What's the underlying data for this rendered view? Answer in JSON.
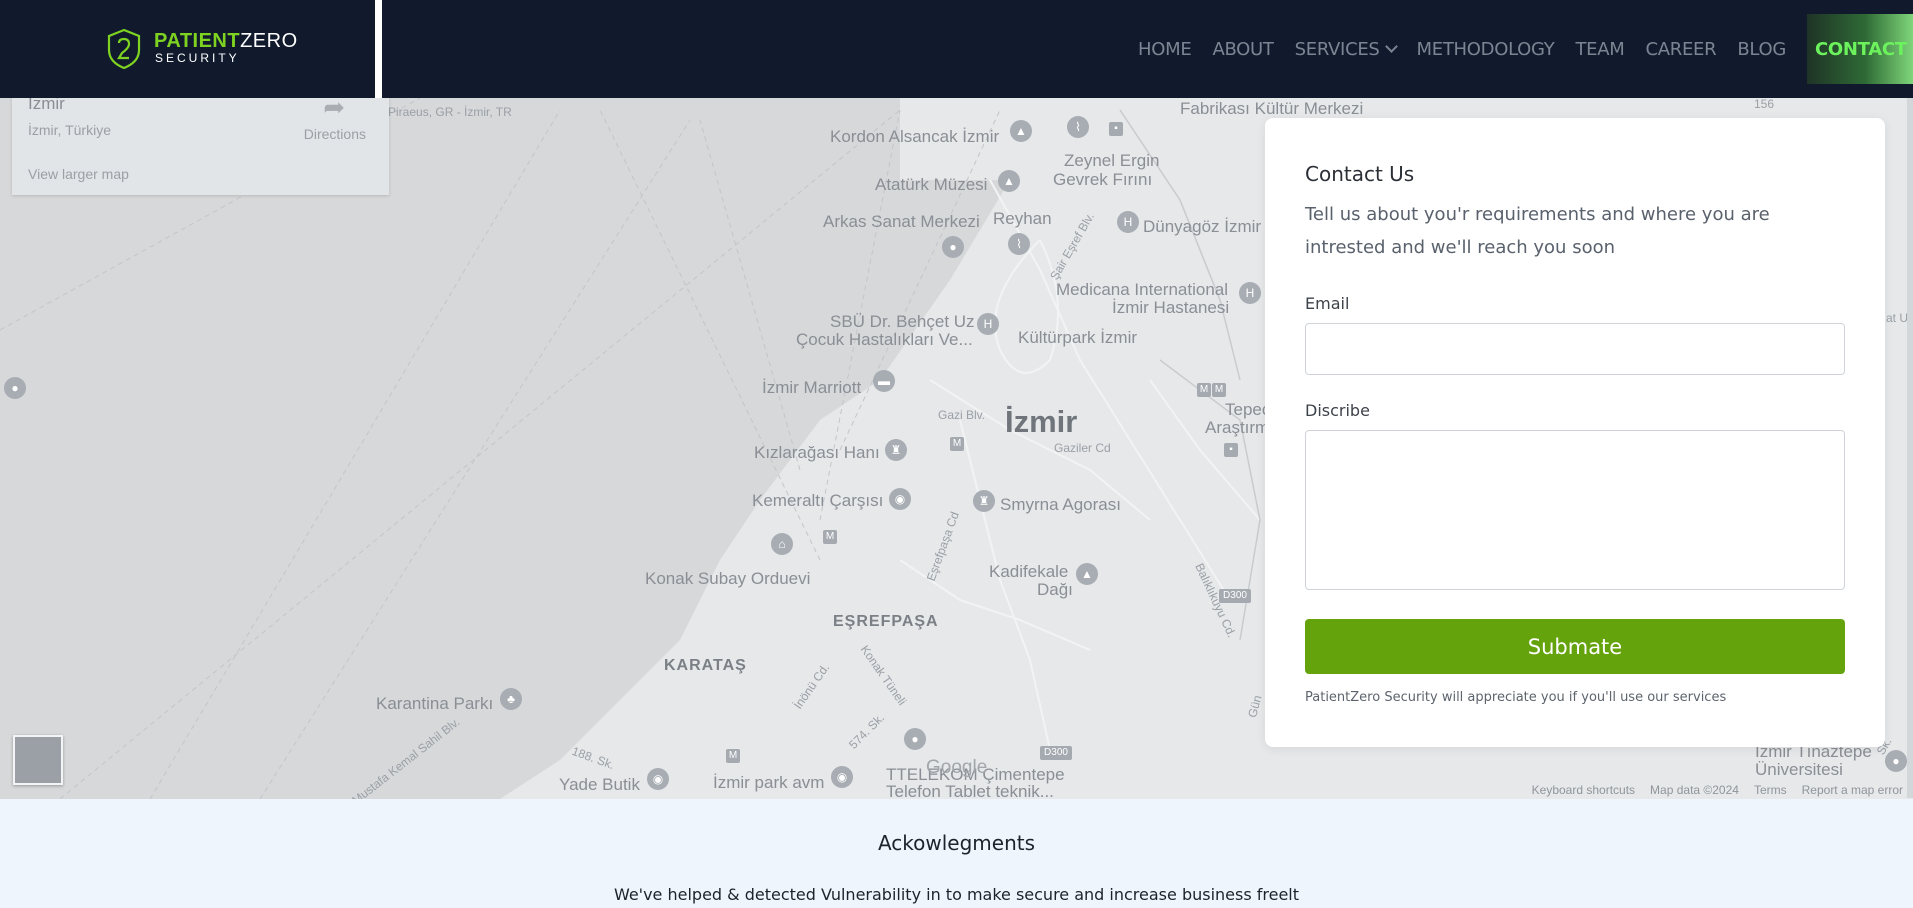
{
  "brand": {
    "name_part1": "PATIENT",
    "name_part2": "ZERO",
    "tagline": "SECURITY"
  },
  "nav": {
    "items": [
      "HOME",
      "ABOUT",
      "SERVICES",
      "METHODOLOGY",
      "TEAM",
      "CAREER",
      "BLOG"
    ],
    "contact_label": "CONTACT"
  },
  "colors": {
    "header_bg": "#111a2d",
    "accent_green": "#7ed321",
    "submit_green": "#65a30d"
  },
  "map": {
    "card": {
      "place": "İzmir",
      "address": "İzmir, Türkiye",
      "directions": "Directions",
      "view_larger": "View larger map"
    },
    "labels": {
      "piraeus": "Piraeus, GR - İzmir, TR",
      "fabrikasi": "Fabrikası Kültür Merkezi",
      "kordon": "Kordon Alsancak İzmir",
      "zeynel": "Zeynel Ergin",
      "gevrek": "Gevrek Fırını",
      "ataturk": "Atatürk Müzesi",
      "arkas": "Arkas Sanat Merkezi",
      "reyhan": "Reyhan",
      "dunyagoz": "Dünyagöz İzmir",
      "sair_esref": "Şair Eşref Blv.",
      "medicana1": "Medicana International",
      "medicana2": "İzmir Hastanesi",
      "sbu1": "SBÜ Dr. Behçet Uz",
      "sbu2": "Çocuk Hastalıkları Ve...",
      "kulturpark": "Kültürpark İzmir",
      "marriott": "İzmir Marriott",
      "gazi": "Gazi Blv.",
      "city": "İzmir",
      "gaziler": "Gaziler Cd",
      "tepec": "Tepec",
      "arastir": "Araştırm",
      "kizlaragasi": "Kızlarağası Hanı",
      "kemeralti": "Kemeraltı Çarşısı",
      "smyrna": "Smyrna Agorası",
      "esrefpasa_cd": "Eşrefpaşa Cd",
      "kadifekale1": "Kadifekale",
      "kadifekale2": "Dağı",
      "konak_subay": "Konak Subay Orduevi",
      "esrefpasa": "EŞREFPAŞA",
      "d300a": "D300",
      "baliklikuyu": "Balıklıkuyu Cd.",
      "karatas": "KARATAŞ",
      "konak_tuneli": "Konak Tüneli",
      "inonu": "İnönü Cd.",
      "karantina": "Karantina Parkı",
      "kemal_sahil": "Mustafa Kemal Sahil Blv.",
      "sk188": "188. Sk.",
      "sk574": "574. Sk.",
      "yade": "Yade Butik",
      "izmir_park": "İzmir park avm",
      "ttelekom1": "TTELEKOM Çimentepe",
      "ttelekom2": "Telefon Tablet teknik...",
      "d300b": "D300",
      "tinaztepe1": "İzmir Tınaztepe",
      "tinaztepe2": "Üniversitesi",
      "gun": "Gün",
      "sk_r": "Sk.",
      "at_u": "at U",
      "n156": "156"
    },
    "google": "Google",
    "footer": [
      "Keyboard shortcuts",
      "Map data ©2024",
      "Terms",
      "Report a map error"
    ]
  },
  "contact": {
    "title": "Contact Us",
    "description": "Tell us about you'r requirements and where you are intrested and we'll reach you soon",
    "email_label": "Email",
    "email_value": "",
    "describe_label": "Discribe",
    "describe_value": "",
    "submit_label": "Submate",
    "note": "PatientZero Security will appreciate you if you'll use our services"
  },
  "ack": {
    "heading": "Ackowlegments",
    "text": "We've helped & detected Vulnerability in to make secure and increase business freelt"
  }
}
